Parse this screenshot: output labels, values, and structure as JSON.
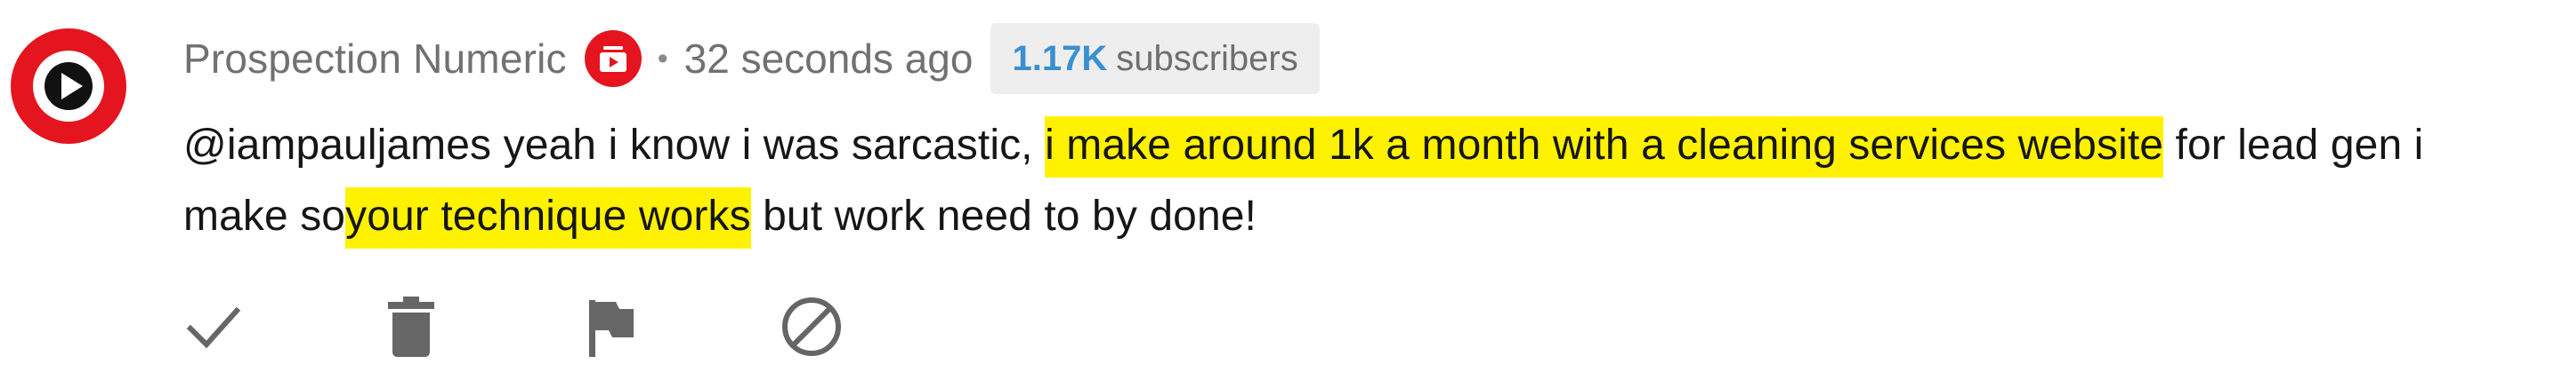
{
  "author": {
    "name": "Prospection Numeric",
    "avatar_icon": "youtube-play-icon",
    "badge_icon": "youtube-studio-badge-icon",
    "brand_color": "#e4151e"
  },
  "separator": "•",
  "timestamp": "32 seconds ago",
  "subscribers": {
    "count": "1.17K",
    "label": "subscribers",
    "count_color": "#3a8fd0"
  },
  "comment": {
    "segments": [
      {
        "text": "@iampauljames yeah i know i was sarcastic, ",
        "highlight": false
      },
      {
        "text": "i make around 1k a month with a cleaning services website",
        "highlight": true
      },
      {
        "text": " for lead gen i make so",
        "highlight": false
      },
      {
        "text": "your technique works",
        "highlight": true
      },
      {
        "text": " but work need to by done!",
        "highlight": false
      }
    ],
    "highlight_color": "#fff200"
  },
  "actions": [
    {
      "name": "approve",
      "icon": "check-icon"
    },
    {
      "name": "remove",
      "icon": "trash-icon"
    },
    {
      "name": "report",
      "icon": "flag-icon"
    },
    {
      "name": "hide-user",
      "icon": "block-icon"
    }
  ]
}
